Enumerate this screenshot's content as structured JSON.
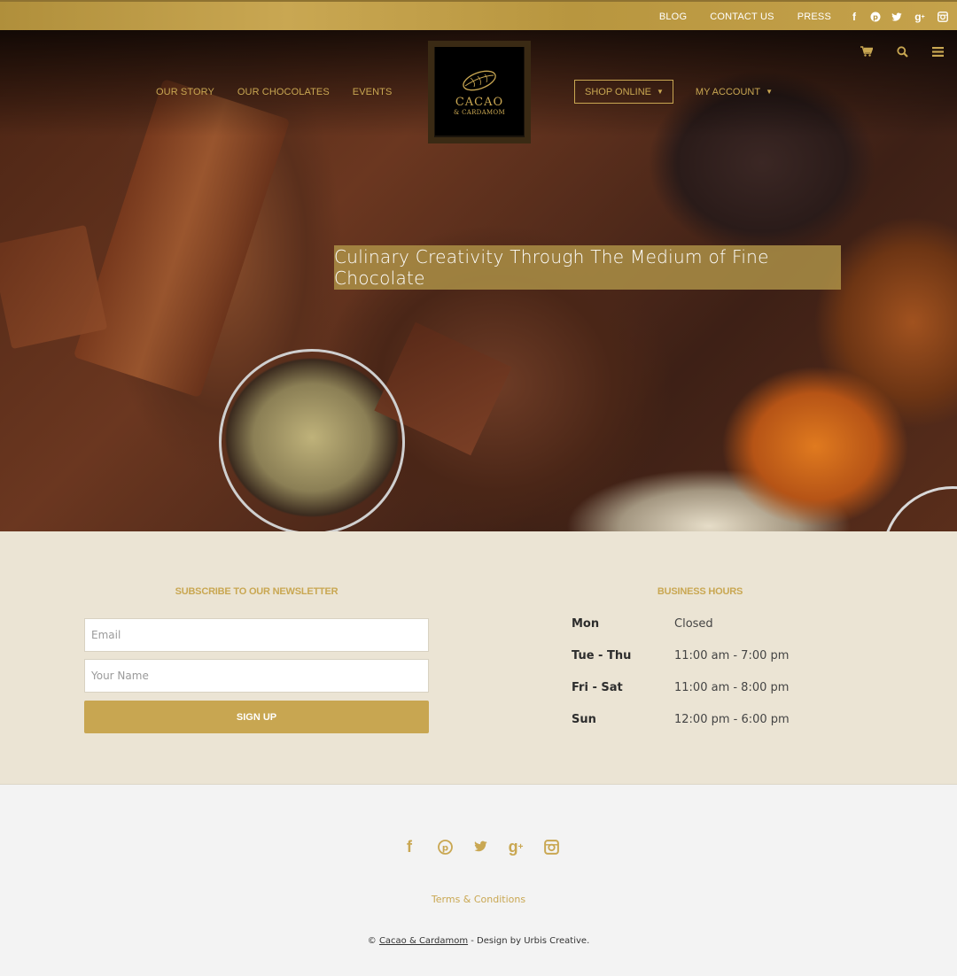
{
  "topbar": {
    "links": [
      "BLOG",
      "CONTACT US",
      "PRESS"
    ],
    "social_icons": [
      "facebook-icon",
      "pinterest-icon",
      "twitter-icon",
      "google-plus-icon",
      "instagram-icon"
    ]
  },
  "nav": {
    "left": [
      "OUR STORY",
      "OUR CHOCOLATES",
      "EVENTS"
    ],
    "shop_online": "SHOP ONLINE",
    "my_account": "MY ACCOUNT"
  },
  "logo": {
    "name": "CACAO",
    "sub": "& CARDAMOM"
  },
  "header_icons": [
    "cart-icon",
    "search-icon",
    "menu-icon"
  ],
  "hero": {
    "tagline": "Culinary Creativity Through The Medium of Fine Chocolate"
  },
  "newsletter": {
    "title": "SUBSCRIBE TO OUR NEWSLETTER",
    "email_placeholder": "Email",
    "name_placeholder": "Your Name",
    "button": "SIGN UP"
  },
  "business_hours": {
    "title": "BUSINESS HOURS",
    "rows": [
      {
        "day": "Mon",
        "time": "Closed"
      },
      {
        "day": "Tue - Thu",
        "time": "11:00 am - 7:00 pm"
      },
      {
        "day": "Fri - Sat",
        "time": "11:00 am - 8:00 pm"
      },
      {
        "day": "Sun",
        "time": "12:00 pm - 6:00 pm"
      }
    ]
  },
  "footer": {
    "terms": "Terms & Conditions",
    "copyright_prefix": "©",
    "brand": "Cacao & Cardamom",
    "credit": " - Design by Urbis Creative."
  },
  "colors": {
    "gold": "#c9a752",
    "section_bg": "#ebe4d4",
    "footer_bg": "#f3f3f3"
  }
}
